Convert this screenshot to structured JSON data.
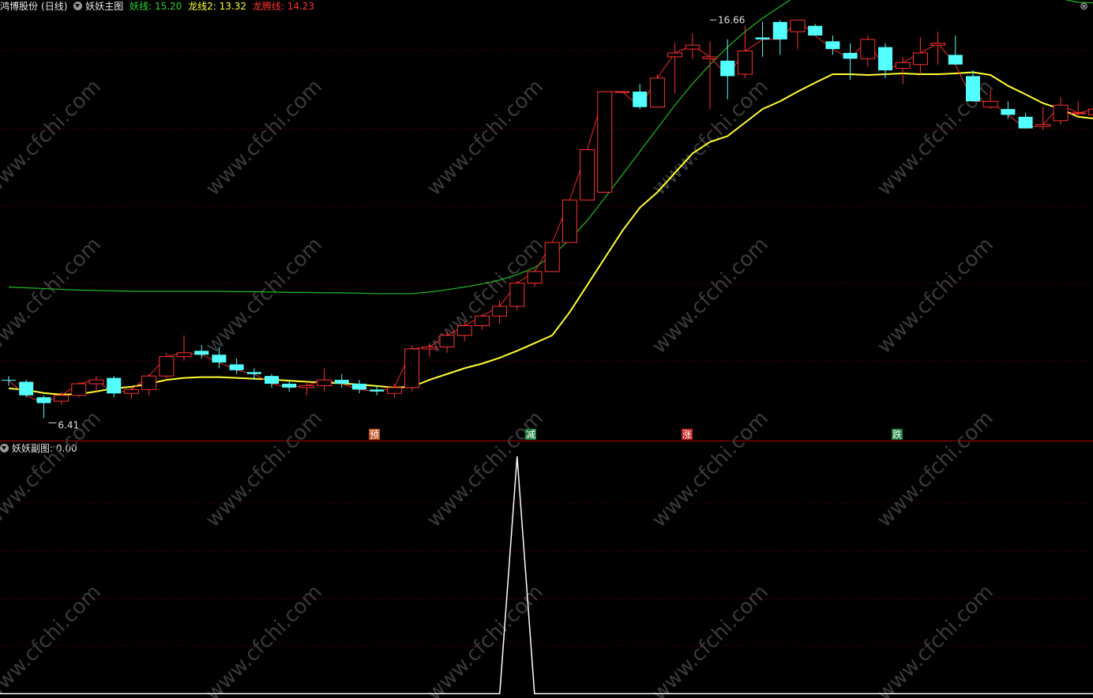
{
  "main_header": {
    "stock_name": "鸿博股份",
    "period": "(日线)",
    "indicator_name": "妖妖主图",
    "lines": [
      {
        "label": "妖线:",
        "value": "15.20",
        "color": "#2dd42d"
      },
      {
        "label": "龙线2:",
        "value": "13.32",
        "color": "#ffff33"
      },
      {
        "label": "龙腾线:",
        "value": "14.23",
        "color": "#ff3333"
      }
    ]
  },
  "sub_header": {
    "indicator_name": "妖妖副图",
    "value": ": 0.00"
  },
  "annotations": {
    "high_label": "16.66",
    "low_label": "6.41"
  },
  "signals": [
    {
      "text": "预",
      "color": "#c05020"
    },
    {
      "text": "减",
      "color": "#208040"
    },
    {
      "text": "涨",
      "color": "#c02020"
    },
    {
      "text": "跌",
      "color": "#208040"
    }
  ],
  "watermark": "www.cfchi.com",
  "colors": {
    "up": "#ff3333",
    "down": "#54ffff",
    "yao_line": "#22bb22",
    "long_line": "#ffff33",
    "grid": "#7a0000",
    "sub_line": "#ffffff"
  },
  "chart_data": {
    "type": "candlestick",
    "x_label": "",
    "y_label": "",
    "candles_ohlc": [
      [
        7.4,
        7.5,
        7.25,
        7.38
      ],
      [
        7.35,
        7.4,
        6.95,
        7.0
      ],
      [
        6.95,
        7.0,
        6.41,
        6.8
      ],
      [
        6.85,
        7.1,
        6.75,
        7.0
      ],
      [
        7.0,
        7.35,
        6.95,
        7.3
      ],
      [
        7.3,
        7.5,
        7.1,
        7.4
      ],
      [
        7.45,
        7.5,
        6.95,
        7.05
      ],
      [
        7.05,
        7.2,
        6.9,
        7.15
      ],
      [
        7.15,
        7.55,
        7.0,
        7.5
      ],
      [
        7.5,
        8.1,
        7.4,
        8.0
      ],
      [
        8.0,
        8.55,
        7.9,
        8.1
      ],
      [
        8.15,
        8.3,
        7.95,
        8.05
      ],
      [
        8.05,
        8.25,
        7.7,
        7.85
      ],
      [
        7.8,
        7.95,
        7.55,
        7.65
      ],
      [
        7.6,
        7.7,
        7.4,
        7.55
      ],
      [
        7.5,
        7.55,
        7.2,
        7.3
      ],
      [
        7.3,
        7.4,
        7.1,
        7.2
      ],
      [
        7.2,
        7.35,
        7.0,
        7.25
      ],
      [
        7.25,
        7.7,
        7.1,
        7.4
      ],
      [
        7.4,
        7.55,
        7.2,
        7.3
      ],
      [
        7.3,
        7.4,
        7.05,
        7.15
      ],
      [
        7.15,
        7.25,
        7.0,
        7.1
      ],
      [
        7.05,
        7.3,
        6.95,
        7.2
      ],
      [
        7.2,
        8.3,
        7.1,
        8.2
      ],
      [
        8.2,
        8.35,
        8.0,
        8.25
      ],
      [
        8.25,
        8.65,
        8.1,
        8.55
      ],
      [
        8.55,
        8.9,
        8.4,
        8.8
      ],
      [
        8.8,
        9.1,
        8.7,
        9.05
      ],
      [
        9.05,
        9.45,
        8.85,
        9.3
      ],
      [
        9.3,
        9.95,
        9.2,
        9.9
      ],
      [
        9.9,
        10.25,
        9.8,
        10.2
      ],
      [
        10.2,
        10.95,
        10.2,
        10.95
      ],
      [
        10.95,
        12.05,
        10.95,
        12.05
      ],
      [
        12.05,
        13.35,
        12.05,
        13.35
      ],
      [
        12.25,
        14.85,
        12.25,
        14.85
      ],
      [
        14.85,
        14.85,
        14.85,
        14.85
      ],
      [
        14.85,
        15.05,
        14.4,
        14.45
      ],
      [
        14.45,
        15.3,
        14.5,
        15.2
      ],
      [
        15.75,
        16.1,
        14.8,
        15.85
      ],
      [
        15.95,
        16.35,
        15.7,
        16.05
      ],
      [
        15.7,
        16.15,
        14.4,
        15.75
      ],
      [
        15.65,
        16.2,
        14.65,
        15.25
      ],
      [
        15.3,
        16.55,
        15.2,
        15.9
      ],
      [
        16.25,
        16.66,
        15.75,
        16.2
      ],
      [
        16.65,
        16.7,
        15.8,
        16.2
      ],
      [
        16.4,
        16.66,
        15.95,
        16.7
      ],
      [
        16.55,
        16.6,
        16.35,
        16.3
      ],
      [
        16.15,
        16.3,
        15.8,
        15.95
      ],
      [
        15.85,
        16.1,
        15.15,
        15.7
      ],
      [
        15.7,
        16.3,
        15.5,
        16.2
      ],
      [
        16.0,
        16.1,
        15.2,
        15.4
      ],
      [
        15.45,
        15.75,
        15.05,
        15.6
      ],
      [
        15.55,
        16.25,
        15.3,
        15.85
      ],
      [
        16.05,
        16.4,
        15.55,
        16.1
      ],
      [
        15.8,
        16.3,
        15.7,
        15.55
      ],
      [
        15.25,
        15.4,
        14.6,
        14.6
      ],
      [
        14.45,
        14.9,
        14.4,
        14.6
      ],
      [
        14.4,
        14.6,
        14.15,
        14.25
      ],
      [
        14.2,
        14.3,
        13.95,
        13.9
      ],
      [
        13.95,
        14.45,
        13.85,
        14.0
      ],
      [
        14.1,
        14.7,
        14.0,
        14.5
      ],
      [
        14.3,
        14.6,
        14.2,
        14.3
      ],
      [
        14.25,
        14.3,
        14.0,
        14.4
      ]
    ],
    "yao_line": [
      9.8,
      9.78,
      9.76,
      9.74,
      9.72,
      9.71,
      9.7,
      9.69,
      9.69,
      9.69,
      9.69,
      9.69,
      9.69,
      9.68,
      9.68,
      9.67,
      9.66,
      9.66,
      9.65,
      9.65,
      9.64,
      9.63,
      9.63,
      9.63,
      9.67,
      9.73,
      9.8,
      9.88,
      9.98,
      10.12,
      10.3,
      10.62,
      11.02,
      11.52,
      12.1,
      12.7,
      13.3,
      13.9,
      14.5,
      15.05,
      15.55,
      16.0,
      16.4,
      16.75,
      17.05,
      17.35,
      17.55,
      17.72,
      17.86,
      17.98,
      18.08,
      18.15,
      18.2,
      18.24,
      18.21,
      18.12,
      17.98,
      17.8,
      17.6,
      17.4,
      17.25,
      17.16,
      17.14
    ],
    "long_line": [
      7.18,
      7.14,
      7.06,
      7.02,
      7.03,
      7.1,
      7.18,
      7.22,
      7.3,
      7.4,
      7.45,
      7.47,
      7.47,
      7.45,
      7.43,
      7.41,
      7.38,
      7.35,
      7.33,
      7.31,
      7.28,
      7.24,
      7.2,
      7.22,
      7.4,
      7.55,
      7.7,
      7.82,
      7.97,
      8.15,
      8.35,
      8.55,
      9.15,
      9.85,
      10.55,
      11.25,
      11.85,
      12.25,
      12.75,
      13.25,
      13.55,
      13.7,
      14.05,
      14.4,
      14.6,
      14.85,
      15.08,
      15.3,
      15.3,
      15.28,
      15.3,
      15.32,
      15.3,
      15.3,
      15.32,
      15.35,
      15.28,
      15.0,
      14.78,
      14.55,
      14.4,
      14.2,
      14.15,
      14.15,
      14.4
    ],
    "longteng_line_tail": [
      14.4,
      15.6
    ],
    "sub_series": {
      "name": "妖妖副图",
      "spike_value": 1,
      "spike_candle_index": 29
    }
  }
}
